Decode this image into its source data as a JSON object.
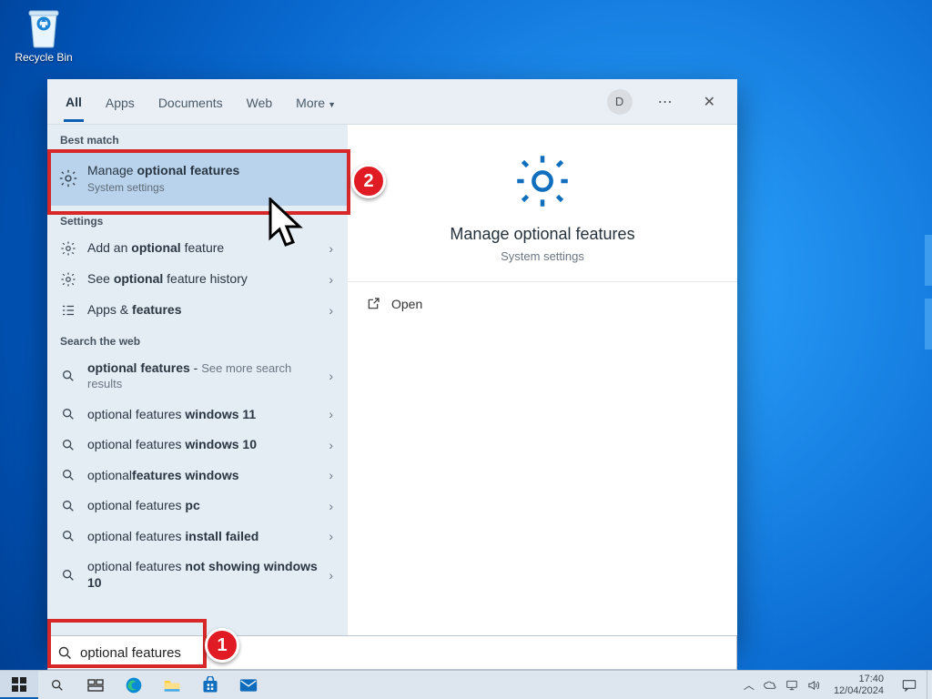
{
  "desktop": {
    "recycle_bin": "Recycle Bin"
  },
  "search": {
    "tabs": {
      "all": "All",
      "apps": "Apps",
      "documents": "Documents",
      "web": "Web",
      "more": "More"
    },
    "avatar_initial": "D",
    "best_match_label": "Best match",
    "best_match": {
      "title_pre": "Manage ",
      "title_bold": "optional features",
      "subtitle": "System settings"
    },
    "settings_label": "Settings",
    "settings": [
      {
        "pre": "Add an ",
        "bold": "optional",
        "post": " feature"
      },
      {
        "pre": "See ",
        "bold": "optional",
        "post": " feature history"
      },
      {
        "pre": "Apps & ",
        "bold": "features",
        "post": ""
      }
    ],
    "web_label": "Search the web",
    "web": [
      {
        "pre": "",
        "bold": "optional features",
        "post": " - ",
        "hint": "See more search results"
      },
      {
        "pre": "optional features ",
        "bold": "windows 11",
        "post": ""
      },
      {
        "pre": "optional features ",
        "bold": "windows 10",
        "post": ""
      },
      {
        "pre": "optional",
        "bold": "features windows",
        "post": ""
      },
      {
        "pre": "optional features ",
        "bold": "pc",
        "post": ""
      },
      {
        "pre": "optional features ",
        "bold": "install failed",
        "post": ""
      },
      {
        "pre": "optional features ",
        "bold": "not showing windows 10",
        "post": ""
      }
    ],
    "hero": {
      "title": "Manage optional features",
      "subtitle": "System settings"
    },
    "open_label": "Open",
    "query": "optional features"
  },
  "taskbar": {
    "time": "17:40",
    "date": "12/04/2024"
  },
  "annotations": {
    "one": "1",
    "two": "2"
  }
}
